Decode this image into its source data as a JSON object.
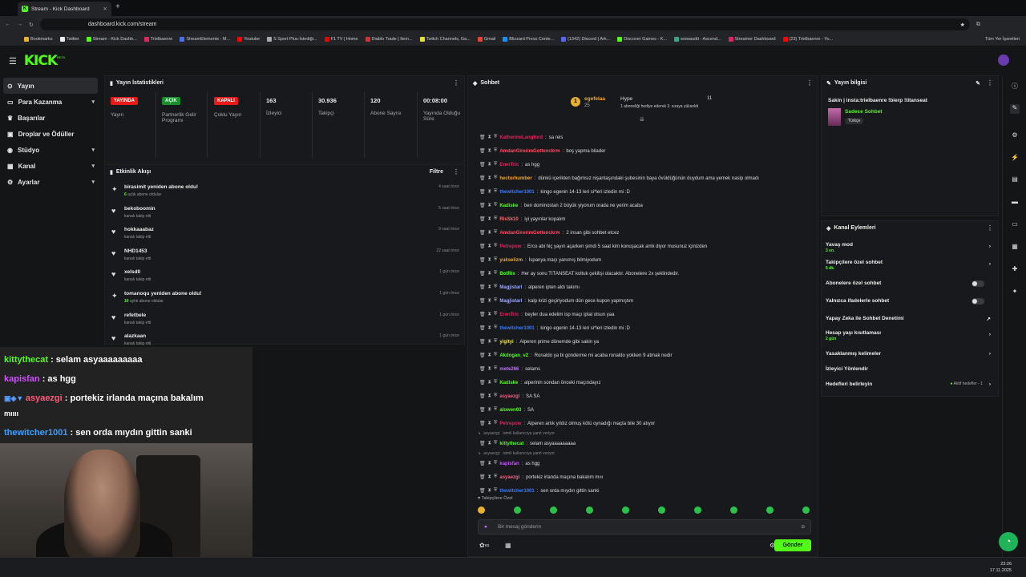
{
  "browser": {
    "tab_title": "Stream - Kick Dashboard",
    "url": "dashboard.kick.com/stream",
    "all_bookmarks": "Tüm Yer İşaretleri",
    "bookmarks": [
      "Bookmarks",
      "Twitter",
      "Stream - Kick Dashb...",
      "Trielbaenre",
      "StreamElements - M...",
      "Youtube",
      "S Sport Plus-İstediği...",
      "F1 TV | Home",
      "Diablo Trade | Item...",
      "Twitch Channels, Ga...",
      "Gmail",
      "Blizzard Press Cente...",
      "(1342) Discord | Ark...",
      "Discover Games - K...",
      "wowaudit - Ascend...",
      "Streamer Dashboard",
      "(23) Trielbaenre - Yo..."
    ]
  },
  "app": {
    "logo": "KICK",
    "beta": "BETA"
  },
  "sidebar": {
    "items": [
      {
        "label": "Yayın"
      },
      {
        "label": "Para Kazanma"
      },
      {
        "label": "Başarılar"
      },
      {
        "label": "Droplar ve Ödüller"
      },
      {
        "label": "Stüdyo"
      },
      {
        "label": "Kanal"
      },
      {
        "label": "Ayarlar"
      }
    ]
  },
  "stats": {
    "title": "Yayın İstatistikleri",
    "cols": [
      {
        "value": "YAYINDA",
        "label": "Yayın",
        "color": "#e91916"
      },
      {
        "value": "AÇIK",
        "label": "Partnerlik Gelir Programı",
        "color": "#1a8f2d"
      },
      {
        "value": "KAPALI",
        "label": "Çoklu Yayın",
        "color": "#e91916"
      },
      {
        "value": "163",
        "label": "İzleyici"
      },
      {
        "value": "30.936",
        "label": "Takipçi"
      },
      {
        "value": "120",
        "label": "Abone Sayısı"
      },
      {
        "value": "00:08:00",
        "label": "Yayında Olduğu Süre"
      }
    ]
  },
  "activity": {
    "title": "Etkinlik Akışı",
    "filter": "Filtre",
    "items": [
      {
        "icon": "star",
        "title": "birasimit yeniden abone oldu!",
        "sub_num": "6",
        "sub": "aylık abone oldular",
        "time": "4 saat önce"
      },
      {
        "icon": "heart",
        "title": "bekoboomin",
        "sub": "kanalı takip etti",
        "time": "5 saat önce"
      },
      {
        "icon": "heart",
        "title": "hokkaaabaz",
        "sub": "kanalı takip etti",
        "time": "9 saat önce"
      },
      {
        "icon": "heart",
        "title": "NHD1453",
        "sub": "kanalı takip etti",
        "time": "22 saat önce"
      },
      {
        "icon": "heart",
        "title": "xelsdll",
        "sub": "kanalı takip etti",
        "time": "1 gün önce"
      },
      {
        "icon": "star",
        "title": "tomanoqu yeniden abone oldu!",
        "sub_num": "10",
        "sub": "aylık abone oldular",
        "time": "1 gün önce"
      },
      {
        "icon": "heart",
        "title": "refetbele",
        "sub": "kanalı takip etti",
        "time": "1 gün önce"
      },
      {
        "icon": "heart",
        "title": "alazkaan",
        "sub": "kanalı takip etti",
        "time": "1 gün önce"
      }
    ]
  },
  "overlay": {
    "lines": [
      {
        "user": "kittythecat",
        "color": "#53fc18",
        "text": " : selam asyaaaaaaaaa"
      },
      {
        "user": "kapisfan",
        "color": "#d04fff",
        "text": " : as hgg"
      },
      {
        "user": "asyaezgi",
        "color": "#ff5a7a",
        "text": " : portekiz irlanda maçına bakalım"
      },
      {
        "user": "",
        "color": "#fff",
        "text": "mıııı"
      },
      {
        "user": "thewitcher1001",
        "color": "#3aa0ff",
        "text": " : sen orda mıydın gittin sanki"
      }
    ]
  },
  "chat": {
    "title": "Sohbet",
    "hype": {
      "user": "egefelaa",
      "count": "25",
      "label": "Hype",
      "level": "11",
      "desc": "1 aboneliği hediye ederek 3. sıraya yükseldi"
    },
    "messages": [
      {
        "user": "KatherineLangford",
        "color": "#e0245e",
        "text": "sa reis"
      },
      {
        "user": "AmdanGirerimGottenckrm",
        "color": "#ff4d6a",
        "text": "boş yapma bilader"
      },
      {
        "user": "ErenTric",
        "color": "#e0245e",
        "text": "as hgg"
      },
      {
        "user": "hectorhumber",
        "color": "#f5a623",
        "text": "dünkü içerikten bağımsız nişantaşındaki şubesinin baya övüldüğünün duydum ama yemek nasip olmadı"
      },
      {
        "user": "thewitcher1001",
        "color": "#3a7bff",
        "text": "kingo egenin 14-13 leri si*leri izledin mi :D"
      },
      {
        "user": "Kadiske",
        "color": "#53fc18",
        "text": "ben dominostan 2 büyük yiyorum orada ne yerim acaba"
      },
      {
        "user": "RisSk10",
        "color": "#ff6b6b",
        "text": "iyi yayınlar kopalım"
      },
      {
        "user": "AmdanGirerimGottenckrm",
        "color": "#ff4d6a",
        "text": "2 insan gibi sohbet etcez"
      },
      {
        "user": "Petrepow",
        "color": "#e0245e",
        "text": "Erco abi hiç yayın açarken şimdi 5 saat kim konuşacak amk diyor musunuz içinizden"
      },
      {
        "user": "yukselizm",
        "color": "#f5a623",
        "text": "İspanya maçı yanımış bilmiyodum"
      },
      {
        "user": "BotRix",
        "color": "#53fc18",
        "text": "Her ay sonu TITANSEAT koltuk çekilişi olacaktır. Abonelere 2x şeklindedir."
      },
      {
        "user": "Magjistarl",
        "color": "#9aa8ff",
        "text": "alperen ipten aldı takımı"
      },
      {
        "user": "Magjistarl",
        "color": "#9aa8ff",
        "text": "kalp krizi geçiriyodum dün gece kupon yapmıştım"
      },
      {
        "user": "ErenTric",
        "color": "#e0245e",
        "text": "beyler dua edelim isp maçı iptal olsun yaa"
      },
      {
        "user": "thewitcher1001",
        "color": "#3a7bff",
        "text": "kingo egenin 14-13 leri si*leri izledin mi :D"
      },
      {
        "user": "yigityi",
        "color": "#f5e623",
        "text": "Alperen prime dönemde gibi sakin ya"
      },
      {
        "user": "Akdogan_v2",
        "color": "#53fc18",
        "text": "Ronaldo ya bi gonderme mi acaba ronaldo yokken 9 atmak nedir"
      },
      {
        "user": "mete266",
        "color": "#c070ff",
        "text": "selams"
      },
      {
        "user": "Kadiske",
        "color": "#53fc18",
        "text": "alperinin sondan önceki maçındayız"
      },
      {
        "user": "asyaezgi",
        "color": "#ff5a7a",
        "text": "SA SA"
      },
      {
        "user": "alowen03",
        "color": "#53fc18",
        "text": "SA"
      },
      {
        "user": "Petrepow",
        "color": "#e0245e",
        "text": "Alperen artık yıldız olmuş kötü oynadığı maçta bile 30 atıyor"
      },
      {
        "user": "kittythecat",
        "color": "#53fc18",
        "text": "selam asyaaaaaaaaa"
      },
      {
        "user": "kapisfan",
        "color": "#d04fff",
        "text": "as hgg"
      },
      {
        "user": "asyaezgi",
        "color": "#ff5a7a",
        "text": "portekiz irlanda maçına bakalım mııı"
      },
      {
        "user": "thewitcher1001",
        "color": "#3a7bff",
        "text": "sen orda mıydın gittin sanki"
      }
    ],
    "reply_prefix": "asyaezgi:",
    "reply_note": "isimli kullanıcıya yanıt veriyor",
    "followers_only": "Takipçilere Özel",
    "placeholder": "Bir mesaj gönderin",
    "send": "Gönder"
  },
  "streaminfo": {
    "title": "Yayın bilgisi",
    "stream_title": "Sakin | insta:trielbaenre !bierp !titanseat",
    "category": "Sadece Sohbet",
    "lang": "Türkçe"
  },
  "actions": {
    "title": "Kanal Eylemleri",
    "items": [
      {
        "label": "Yavaş mod",
        "sub": "3 sn."
      },
      {
        "label": "Takipçilere özel sohbet",
        "sub": "6 dk."
      },
      {
        "label": "Abonelere özel sohbet",
        "sub": ""
      },
      {
        "label": "Yalnızca ifadelerle sohbet",
        "sub": ""
      },
      {
        "label": "Yapay Zeka ile Sohbet Denetimi",
        "sub": ""
      },
      {
        "label": "Hesap yaşı kısıtlaması",
        "sub": "2 gün"
      },
      {
        "label": "Yasaklanmış kelimeler",
        "sub": ""
      },
      {
        "label": "İzleyici Yönlendir",
        "sub": ""
      },
      {
        "label": "Hedefleri belirleyin",
        "sub": "",
        "extra": "Aktif hedefler - 1"
      }
    ]
  },
  "taskbar": {
    "time": "23:26",
    "date": "17.11.2025"
  }
}
